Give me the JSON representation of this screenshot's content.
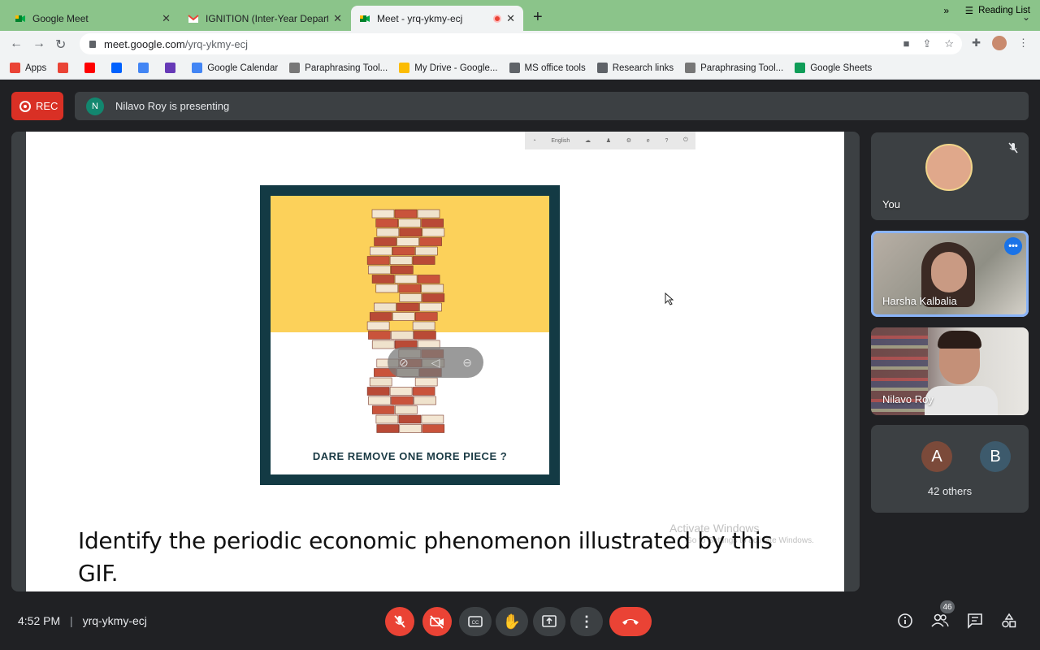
{
  "browser": {
    "tabs": [
      {
        "title": "Google Meet",
        "favicon": "meet-icon",
        "active": false
      },
      {
        "title": "IGNITION (Inter-Year Departme",
        "favicon": "gmail-icon",
        "active": false
      },
      {
        "title": "Meet - yrq-ykmy-ecj",
        "favicon": "meet-icon",
        "active": true
      }
    ],
    "url_host": "meet.google.com",
    "url_path": "/yrq-ykmy-ecj",
    "bookmarks": [
      {
        "label": "Apps",
        "icon": "apps-grid-icon",
        "color": "#ea4335"
      },
      {
        "label": "",
        "icon": "gmail-icon",
        "color": "#ea4335"
      },
      {
        "label": "",
        "icon": "youtube-icon",
        "color": "#ff0000"
      },
      {
        "label": "",
        "icon": "dropbox-icon",
        "color": "#0061fe"
      },
      {
        "label": "",
        "icon": "docs-icon",
        "color": "#4285f4"
      },
      {
        "label": "",
        "icon": "forms-icon",
        "color": "#673ab7"
      },
      {
        "label": "Google Calendar",
        "icon": "calendar-icon",
        "color": "#4285f4"
      },
      {
        "label": "Paraphrasing Tool...",
        "icon": "feather-icon",
        "color": "#777777"
      },
      {
        "label": "My Drive - Google...",
        "icon": "drive-icon",
        "color": "#fbbc04"
      },
      {
        "label": "MS office tools",
        "icon": "folder-icon",
        "color": "#5f6368"
      },
      {
        "label": "Research links",
        "icon": "folder-icon",
        "color": "#5f6368"
      },
      {
        "label": "Paraphrasing Tool...",
        "icon": "feather-icon",
        "color": "#777777"
      },
      {
        "label": "Google Sheets",
        "icon": "sheets-icon",
        "color": "#0f9d58"
      }
    ],
    "reading_list": "Reading List",
    "overflow": "»"
  },
  "meet": {
    "rec_label": "REC",
    "presenter_initial": "N",
    "presenting_text": "Nilavo Roy is presenting",
    "slide": {
      "toolbar_lang": "English",
      "gif_caption": "DARE REMOVE ONE MORE PIECE ?",
      "question": "Identify the periodic economic phenomenon illustrated by this GIF.",
      "watermark_title": "Activate Windows",
      "watermark_sub": "Go to Settings to activate Windows."
    },
    "participants": [
      {
        "name": "You",
        "muted": true
      },
      {
        "name": "Harsha Kalbalia",
        "pinned": true
      },
      {
        "name": "Nilavo Roy"
      }
    ],
    "others": {
      "initials": [
        "A",
        "B"
      ],
      "label": "42 others",
      "colors": [
        "#7b4a3a",
        "#3d5a6c"
      ]
    },
    "bottom": {
      "time": "4:52 PM",
      "separator": "|",
      "meeting_code": "yrq-ykmy-ecj",
      "people_count": "46"
    },
    "colors": {
      "accent_red": "#ea4335",
      "rec_red": "#d93025",
      "pin_blue": "#8ab4f8"
    }
  }
}
